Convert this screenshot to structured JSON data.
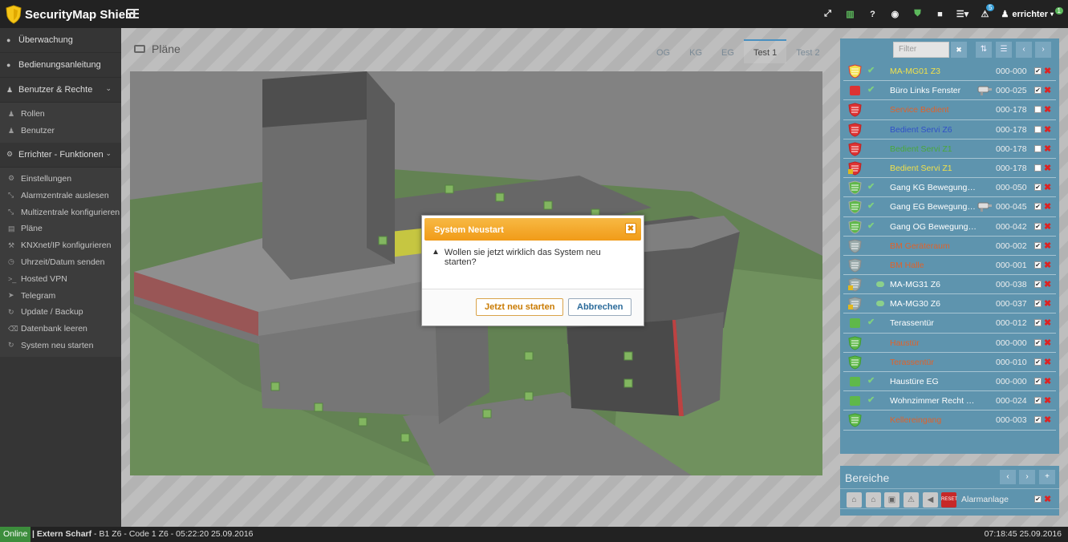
{
  "app": {
    "title": "SecurityMap Shield"
  },
  "topbar": {
    "icons": [
      {
        "name": "fullscreen-icon",
        "glyph": "⤢"
      },
      {
        "name": "columns-icon",
        "glyph": "▥"
      },
      {
        "name": "help-icon",
        "glyph": "?"
      },
      {
        "name": "eye-icon",
        "glyph": "◉"
      },
      {
        "name": "shield-status-icon",
        "glyph": "⛊"
      },
      {
        "name": "camera-icon",
        "glyph": "■"
      },
      {
        "name": "list-menu-icon",
        "glyph": "☰▾"
      },
      {
        "name": "alert-icon",
        "glyph": "⚠",
        "badge": "5"
      }
    ],
    "user": {
      "name": "errichter",
      "badge": "1"
    }
  },
  "sidebar": {
    "items": [
      {
        "label": "Überwachung",
        "icon": "●"
      },
      {
        "label": "Bedienungsanleitung",
        "icon": "●"
      },
      {
        "label": "Benutzer & Rechte",
        "icon": "👥"
      },
      {
        "label": "Errichter - Funktionen",
        "icon": "⚙"
      }
    ],
    "users_sub": [
      {
        "label": "Rollen",
        "icon": "♟"
      },
      {
        "label": "Benutzer",
        "icon": "♟"
      }
    ],
    "errichter_sub": [
      {
        "label": "Einstellungen",
        "icon": "⚙"
      },
      {
        "label": "Alarmzentrale auslesen",
        "icon": "⤡"
      },
      {
        "label": "Multizentrale konfigurieren",
        "icon": "⤡"
      },
      {
        "label": "Pläne",
        "icon": "▤"
      },
      {
        "label": "KNXnet/IP konfigurieren",
        "icon": "⚒"
      },
      {
        "label": "Uhrzeit/Datum senden",
        "icon": "◷"
      },
      {
        "label": "Hosted VPN",
        "icon": ">_"
      },
      {
        "label": "Telegram",
        "icon": "➤"
      },
      {
        "label": "Update / Backup",
        "icon": "↻"
      },
      {
        "label": "Datenbank leeren",
        "icon": "⌫"
      },
      {
        "label": "System neu starten",
        "icon": "↻"
      }
    ]
  },
  "main": {
    "title": "Pläne",
    "tabs": [
      "OG",
      "KG",
      "EG",
      "Test 1",
      "Test 2"
    ],
    "active_tab": "Test 1"
  },
  "zones": {
    "filter_placeholder": "Filter",
    "rows": [
      {
        "name": "MA-MG01 Z3",
        "code": "000-000",
        "color": "#f0e04a",
        "shield": "yellowred",
        "ok": true,
        "cam": false,
        "checked": true
      },
      {
        "name": "Büro Links Fenster",
        "code": "000-025",
        "color": "#ffffff",
        "shield": "redsquare",
        "ok": true,
        "cam": true,
        "checked": true
      },
      {
        "name": "Service Bedient",
        "code": "000-178",
        "color": "#e0622a",
        "shield": "red",
        "ok": false,
        "cam": false,
        "checked": false
      },
      {
        "name": "Bedient Servi Z6",
        "code": "000-178",
        "color": "#3050c8",
        "shield": "red",
        "ok": false,
        "cam": false,
        "checked": false
      },
      {
        "name": "Bedient Servi Z1",
        "code": "000-178",
        "color": "#4aa83a",
        "shield": "red",
        "ok": false,
        "cam": false,
        "checked": false
      },
      {
        "name": "Bedient Servi Z1",
        "code": "000-178",
        "color": "#f0e04a",
        "shield": "redlock",
        "ok": false,
        "cam": false,
        "checked": false
      },
      {
        "name": "Gang KG Bewegungsmelder",
        "code": "000-050",
        "color": "#ffffff",
        "shield": "greengray",
        "ok": true,
        "cam": false,
        "checked": true
      },
      {
        "name": "Gang EG Bewegungsmelder",
        "code": "000-045",
        "color": "#ffffff",
        "shield": "greengray",
        "ok": true,
        "cam": true,
        "checked": true
      },
      {
        "name": "Gang OG Bewegungsmelder",
        "code": "000-042",
        "color": "#ffffff",
        "shield": "greengray",
        "ok": true,
        "cam": false,
        "checked": true
      },
      {
        "name": "BM Geräteraum",
        "code": "000-002",
        "color": "#e0622a",
        "shield": "gray",
        "ok": false,
        "cam": false,
        "checked": true
      },
      {
        "name": "BM Halle",
        "code": "000-001",
        "color": "#e0622a",
        "shield": "gray",
        "ok": false,
        "cam": false,
        "checked": true
      },
      {
        "name": "MA-MG31 Z6",
        "code": "000-038",
        "color": "#ffffff",
        "shield": "graylock",
        "ok": false,
        "speech": true,
        "cam": false,
        "checked": true
      },
      {
        "name": "MA-MG30 Z6",
        "code": "000-037",
        "color": "#ffffff",
        "shield": "graylock",
        "ok": false,
        "speech": true,
        "cam": false,
        "checked": true
      },
      {
        "name": "Terassentür",
        "code": "000-012",
        "color": "#ffffff",
        "shield": "greensquare",
        "ok": true,
        "cam": false,
        "checked": true
      },
      {
        "name": "Haustür",
        "code": "000-000",
        "color": "#e0622a",
        "shield": "green",
        "ok": false,
        "cam": false,
        "checked": true
      },
      {
        "name": "Terassentür",
        "code": "000-010",
        "color": "#e0622a",
        "shield": "green",
        "ok": false,
        "cam": false,
        "checked": true
      },
      {
        "name": "Haustüre EG",
        "code": "000-000",
        "color": "#ffffff",
        "shield": "greensquare",
        "ok": true,
        "cam": false,
        "checked": true
      },
      {
        "name": "Wohnzimmer Recht Fenster",
        "code": "000-024",
        "color": "#ffffff",
        "shield": "greensquare",
        "ok": true,
        "cam": false,
        "checked": true
      },
      {
        "name": "Kellereingang",
        "code": "000-003",
        "color": "#e0622a",
        "shield": "green",
        "ok": false,
        "cam": false,
        "checked": true
      }
    ]
  },
  "bereiche": {
    "title": "Bereiche",
    "label": "Alarmanlage",
    "icons": [
      "home-icon",
      "home-partial-icon",
      "lock-icon",
      "warning-icon",
      "siren-icon",
      "reset-icon"
    ],
    "reset_text": "RESET"
  },
  "modal": {
    "title": "System Neustart",
    "message": "Wollen sie jetzt wirklich das System neu starten?",
    "confirm": "Jetzt neu starten",
    "cancel": "Abbrechen"
  },
  "status": {
    "online": "Online",
    "prefix": "| Extern Scharf",
    "message": " - B1 Z6 - Code 1 Z6 - 05:22:20 25.09.2016",
    "time": "07:18:45 25.09.2016"
  },
  "colors": {
    "accent": "#5e94ae",
    "modal_header": "#f19b18",
    "online": "#3c8d3c"
  }
}
